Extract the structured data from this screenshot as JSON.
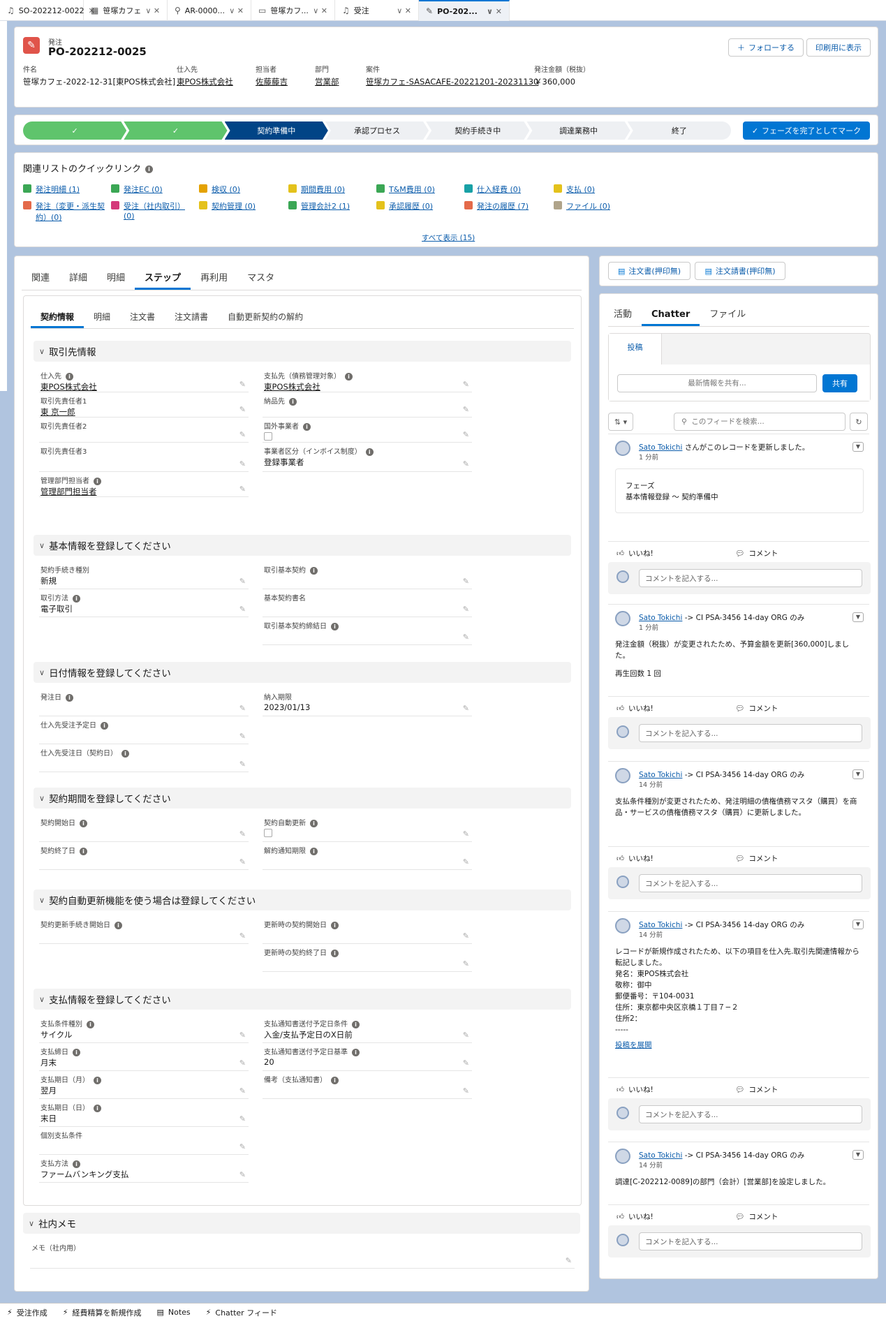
{
  "window_tabs": [
    {
      "icon": "♫",
      "label": "SO-202212-0022",
      "active": false,
      "chevron": false
    },
    {
      "icon": "▦",
      "label": "笹塚カフェ",
      "active": false,
      "chevron": true
    },
    {
      "icon": "⚲",
      "label": "AR-0000...",
      "active": false,
      "chevron": true
    },
    {
      "icon": "▭",
      "label": "笹塚カフ...",
      "active": false,
      "chevron": true
    },
    {
      "icon": "♫",
      "label": "受注",
      "active": false,
      "chevron": true
    },
    {
      "icon": "✎",
      "label": "PO-202...",
      "active": true,
      "chevron": true
    }
  ],
  "record": {
    "object_label": "発注",
    "title": "PO-202212-0025",
    "follow_label": "フォローする",
    "print_label": "印刷用に表示",
    "fields": [
      {
        "label": "件名",
        "value": "笹塚カフェ-2022-12-31[東POS株式会社]",
        "link": false
      },
      {
        "label": "仕入先",
        "value": "東POS株式会社",
        "link": true
      },
      {
        "label": "担当者",
        "value": "佐藤藤吉",
        "link": true
      },
      {
        "label": "部門",
        "value": "営業部",
        "link": true
      },
      {
        "label": "案件",
        "value": "笹塚カフェ-SASACAFE-20221201-20231130",
        "link": true
      },
      {
        "label": "発注金額（税抜）",
        "value": "￥360,000",
        "link": false
      }
    ]
  },
  "path": {
    "steps": [
      "✓",
      "✓",
      "契約準備中",
      "承認プロセス",
      "契約手続き中",
      "調達業務中",
      "終了"
    ],
    "complete_label": "フェーズを完了としてマーク"
  },
  "quicklinks": {
    "title": "関連リストのクイックリンク",
    "items": [
      {
        "label": "発注明細 (1)",
        "color": "#3ba755"
      },
      {
        "label": "発注EC (0)",
        "color": "#3ba755"
      },
      {
        "label": "検収 (0)",
        "color": "#e4a201"
      },
      {
        "label": "期間費用 (0)",
        "color": "#e4c21c"
      },
      {
        "label": "T&M費用 (0)",
        "color": "#3ba755"
      },
      {
        "label": "仕入経費 (0)",
        "color": "#18a1a6"
      },
      {
        "label": "支払 (0)",
        "color": "#e4c21c"
      },
      {
        "label": "発注（変更・派生契約）(0)",
        "color": "#e46a4a"
      },
      {
        "label": "受注（社内取引）(0)",
        "color": "#d4397a"
      },
      {
        "label": "契約管理 (0)",
        "color": "#e4c21c"
      },
      {
        "label": "管理会計2 (1)",
        "color": "#3ba755"
      },
      {
        "label": "承認履歴 (0)",
        "color": "#e4c21c"
      },
      {
        "label": "発注の履歴 (7)",
        "color": "#e46a4a"
      },
      {
        "label": "ファイル (0)",
        "color": "#b0a48a"
      }
    ],
    "show_all": "すべて表示 (15)"
  },
  "main_tabs": [
    "関連",
    "詳細",
    "明細",
    "ステップ",
    "再利用",
    "マスタ"
  ],
  "sub_tabs": [
    "契約情報",
    "明細",
    "注文書",
    "注文請書",
    "自動更新契約の解約"
  ],
  "sections": {
    "s1": {
      "title": "取引先情報",
      "fields": [
        {
          "label": "仕入先",
          "value": "東POS株式会社",
          "link": true,
          "info": true
        },
        {
          "label": "支払先（債務管理対象）",
          "value": "東POS株式会社",
          "link": true,
          "info": true
        },
        {
          "label": "取引先責任者1",
          "value": "東 京一郎",
          "link": true,
          "info": false
        },
        {
          "label": "納品先",
          "value": "",
          "link": false,
          "info": true
        },
        {
          "label": "取引先責任者2",
          "value": "",
          "link": false,
          "info": false
        },
        {
          "label": "国外事業者",
          "value": "",
          "link": false,
          "info": true
        },
        {
          "label": "取引先責任者3",
          "value": "",
          "link": false,
          "info": false
        },
        {
          "label": "事業者区分（インボイス制度）",
          "value": "登録事業者",
          "link": false,
          "info": true
        },
        {
          "label": "管理部門担当者",
          "value": "管理部門担当者",
          "link": true,
          "info": true
        }
      ]
    },
    "s2": {
      "title": "基本情報を登録してください",
      "fields": [
        {
          "label": "契約手続き種別",
          "value": "新規"
        },
        {
          "label": "取引基本契約",
          "value": ""
        },
        {
          "label": "取引方法",
          "value": "電子取引"
        },
        {
          "label": "基本契約書名",
          "value": ""
        },
        {
          "label": "取引基本契約締結日",
          "value": ""
        }
      ]
    },
    "s3": {
      "title": "日付情報を登録してください",
      "fields": [
        {
          "label": "発注日",
          "value": ""
        },
        {
          "label": "納入期限",
          "value": "2023/01/13"
        },
        {
          "label": "仕入先受注予定日",
          "value": ""
        },
        {
          "label": "仕入先受注日（契約日）",
          "value": ""
        }
      ]
    },
    "s4": {
      "title": "契約期間を登録してください",
      "fields": [
        {
          "label": "契約開始日",
          "value": ""
        },
        {
          "label": "契約自動更新",
          "value": ""
        },
        {
          "label": "契約終了日",
          "value": ""
        },
        {
          "label": "解約通知期限",
          "value": ""
        }
      ]
    },
    "s5": {
      "title": "契約自動更新機能を使う場合は登録してください",
      "fields": [
        {
          "label": "契約更新手続き開始日",
          "value": ""
        },
        {
          "label": "更新時の契約開始日",
          "value": ""
        },
        {
          "label": "更新時の契約終了日",
          "value": ""
        }
      ]
    },
    "s6": {
      "title": "支払情報を登録してください",
      "fields": [
        {
          "label": "支払条件種別",
          "value": "サイクル"
        },
        {
          "label": "支払通知書送付予定日条件",
          "value": "入金/支払予定日のX日前"
        },
        {
          "label": "支払締日",
          "value": "月末"
        },
        {
          "label": "支払通知書送付予定日基準",
          "value": "20"
        },
        {
          "label": "支払期日（月）",
          "value": "翌月"
        },
        {
          "label": "備考（支払通知書）",
          "value": ""
        },
        {
          "label": "支払期日（日）",
          "value": "末日"
        },
        {
          "label": "個別支払条件",
          "value": ""
        },
        {
          "label": "支払方法",
          "value": "ファームバンキング支払"
        }
      ]
    },
    "s7": {
      "title": "社内メモ",
      "fields": [
        {
          "label": "メモ（社内用）",
          "value": ""
        }
      ]
    }
  },
  "side": {
    "buttons": [
      "注文書(押印無)",
      "注文請書(押印無)"
    ],
    "tabs": [
      "活動",
      "Chatter",
      "ファイル"
    ],
    "post_tab": "投稿",
    "share_placeholder": "最新情報を共有...",
    "share_button": "共有",
    "search_placeholder": "このフィードを検索...",
    "like": "いいね!",
    "comment": "コメント",
    "comment_placeholder": "コメントを記入する...",
    "posts": [
      {
        "author": "Sato Tokichi",
        "suffix": " さんがこのレコードを更新しました。",
        "time": "1 分前",
        "body": [
          "フェーズ",
          "基本情報登録 〜 契約準備中"
        ]
      },
      {
        "author": "Sato Tokichi",
        "suffix": " -> CI PSA-3456 14-day ORG のみ",
        "time": "1 分前",
        "body": [
          "発注金額（税抜）が変更されたため、予算金額を更新[360,000]しました。",
          "再生回数 1 回"
        ]
      },
      {
        "author": "Sato Tokichi",
        "suffix": " -> CI PSA-3456 14-day ORG のみ",
        "time": "14 分前",
        "body": [
          "支払条件種別が変更されたため、発注明細の債権債務マスタ（購買）を商品・サービスの債権債務マスタ（購買）に更新しました。"
        ]
      },
      {
        "author": "Sato Tokichi",
        "suffix": " -> CI PSA-3456 14-day ORG のみ",
        "time": "14 分前",
        "body": [
          "レコードが新規作成されたため、以下の項目を仕入先.取引先関連情報から転記しました。",
          "発名：東POS株式会社",
          "敬称：御中",
          "郵便番号：〒104-0031",
          "住所：東京都中央区京橋１丁目７−２",
          "住所2：",
          "-----"
        ],
        "expand": "投稿を展開"
      },
      {
        "author": "Sato Tokichi",
        "suffix": " -> CI PSA-3456 14-day ORG のみ",
        "time": "14 分前",
        "body": [
          "調達[C-202212-0089]の部門（会計）[営業部]を設定しました。"
        ]
      }
    ]
  },
  "utility_bar": [
    "受注作成",
    "経費精算を新規作成",
    "Notes",
    "Chatter フィード"
  ]
}
